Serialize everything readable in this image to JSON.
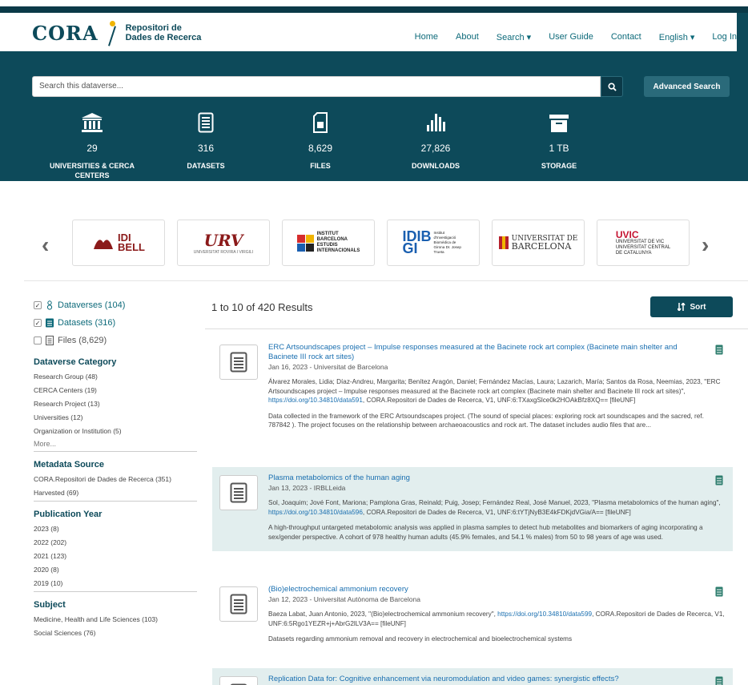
{
  "header": {
    "logo_text": "CORA",
    "logo_sub1": "Repositori de",
    "logo_sub2": "Dades de Recerca",
    "nav": [
      "Home",
      "About",
      "Search ▾",
      "User Guide",
      "Contact",
      "English ▾",
      "Log In"
    ]
  },
  "search": {
    "placeholder": "Search this dataverse...",
    "advanced_label": "Advanced Search"
  },
  "stats": [
    {
      "icon": "university-icon",
      "number": "29",
      "label1": "UNIVERSITIES & CERCA",
      "label2": "CENTERS"
    },
    {
      "icon": "datasets-icon",
      "number": "316",
      "label1": "DATASETS",
      "label2": ""
    },
    {
      "icon": "files-icon",
      "number": "8,629",
      "label1": "FILES",
      "label2": ""
    },
    {
      "icon": "downloads-icon",
      "number": "27,826",
      "label1": "DOWNLOADS",
      "label2": ""
    },
    {
      "icon": "storage-icon",
      "number": "1 TB",
      "label1": "STORAGE",
      "label2": ""
    }
  ],
  "carousel": {
    "logos": [
      {
        "name": "IDIBELL",
        "line1": "IDI",
        "line2": "BELL"
      },
      {
        "name": "Universitat Rovira i Virgili",
        "line1": "URV",
        "line2": "UNIVERSITAT ROVIRA I VIRGILI"
      },
      {
        "name": "Institut Barcelona Estudis Internacionals",
        "line1": "INSTITUT",
        "line2": "BARCELONA",
        "line3": "ESTUDIS",
        "line4": "INTERNACIONALS"
      },
      {
        "name": "IDIBGI",
        "line1": "IDIB",
        "line2": "GI",
        "line3": "Institut d'Investigació Biomèdica de Girona Dr. Josep Trueta"
      },
      {
        "name": "Universitat de Barcelona",
        "line1": "UNIVERSITAT DE",
        "line2": "BARCELONA"
      },
      {
        "name": "UVIC",
        "line1": "UVIC",
        "line2": "UNIVERSITAT DE VIC",
        "line3": "UNIVERSITAT CENTRAL",
        "line4": "DE CATALUNYA"
      }
    ]
  },
  "sidebar": {
    "facets": [
      {
        "label": "Dataverses (104)",
        "checked": true,
        "icon": "dataverse-icon"
      },
      {
        "label": "Datasets (316)",
        "checked": true,
        "icon": "dataset-icon"
      },
      {
        "label": "Files (8,629)",
        "checked": false,
        "icon": "file-icon"
      }
    ],
    "categories": [
      {
        "title": "Dataverse Category",
        "items": [
          "Research Group (48)",
          "CERCA Centers (19)",
          "Research Project (13)",
          "Universities (12)",
          "Organization or Institution (5)"
        ],
        "more": "More..."
      },
      {
        "title": "Metadata Source",
        "items": [
          "CORA.Repositori de Dades de Recerca (351)",
          "Harvested (69)"
        ],
        "more": ""
      },
      {
        "title": "Publication Year",
        "items": [
          "2023 (8)",
          "2022 (202)",
          "2021 (123)",
          "2020 (8)",
          "2019 (10)"
        ],
        "more": ""
      },
      {
        "title": "Subject",
        "items": [
          "Medicine, Health and Life Sciences (103)",
          "Social Sciences (76)"
        ],
        "more": ""
      }
    ]
  },
  "results": {
    "summary": "1 to 10 of 420 Results",
    "sort_label": "Sort",
    "items": [
      {
        "title": "ERC Artsoundscapes project – Impulse responses measured at the Bacinete rock art complex (Bacinete main shelter and Bacinete III rock art sites)",
        "meta": "Jan 16, 2023 - Universitat de Barcelona",
        "cite_a": "Álvarez Morales, Lidia; Díaz-Andreu, Margarita; Benítez Aragón, Daniel; Fernández Macías, Laura; Lazarich, María; Santos da Rosa, Neemias, 2023, \"ERC Artsoundscapes project – Impulse responses measured at the Bacinete rock art complex (Bacinete main shelter and Bacinete III rock art sites)\", ",
        "cite_link": "https://doi.org/10.34810/data591",
        "cite_b": ", CORA.Repositori de Dades de Recerca, V1, UNF:6:TXaxgSlce0k2HOAkBfz8XQ== [fileUNF]",
        "desc": "Data collected in the framework of the ERC Artsoundscapes project. (The sound of special places: exploring rock art soundscapes and the sacred, ref. 787842 ). The project focuses on the relationship between archaeoacoustics and rock art. The dataset includes audio files that are..."
      },
      {
        "title": "Plasma metabolomics of the human aging",
        "meta": "Jan 13, 2023 - IRBLLeida",
        "cite_a": "Sol, Joaquim; Jové Font, Mariona; Pamplona Gras, Reinald; Puig, Josep; Fernández Real, José Manuel, 2023, \"Plasma metabolomics of the human aging\", ",
        "cite_link": "https://doi.org/10.34810/data596",
        "cite_b": ", CORA.Repositori de Dades de Recerca, V1, UNF:6:tYTjNyB3E4kFDKjdVGia/A== [fileUNF]",
        "desc": "A high-throughput untargeted metabolomic analysis was applied in plasma samples to detect hub metabolites and biomarkers of aging incorporating a sex/gender perspective. A cohort of 978 healthy human adults (45.9% females, and 54.1 % males) from 50 to 98 years of age was used."
      },
      {
        "title": "(Bio)electrochemical ammonium recovery",
        "meta": "Jan 12, 2023 - Universitat Autònoma de Barcelona",
        "cite_a": "Baeza Labat, Juan Antonio, 2023, \"(Bio)electrochemical ammonium recovery\", ",
        "cite_link": "https://doi.org/10.34810/data599",
        "cite_b": ", CORA.Repositori de Dades de Recerca, V1, UNF:6:5Rgo1YEZR+j+AbrG2lLV3A== [fileUNF]",
        "desc": "Datasets regarding ammonium removal and recovery in electrochemical and bioelectrochemical systems"
      },
      {
        "title": "Replication Data for: Cognitive enhancement via neuromodulation and video games: synergistic effects?",
        "meta": "",
        "cite_a": "",
        "cite_link": "",
        "cite_b": "",
        "desc": ""
      }
    ]
  }
}
